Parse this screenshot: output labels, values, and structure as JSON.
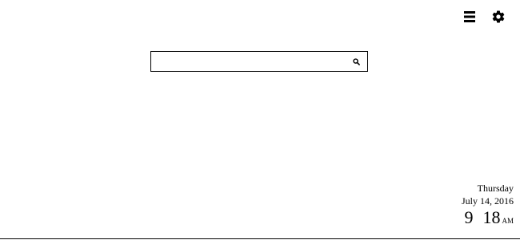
{
  "toolbar": {
    "menu_icon": "hamburger-menu-icon",
    "settings_icon": "gear-icon"
  },
  "search": {
    "value": "",
    "placeholder": "",
    "icon": "search-icon"
  },
  "clock": {
    "day": "Thursday",
    "date": "July 14, 2016",
    "hour": "9",
    "minute": "18",
    "ampm": "AM"
  },
  "colors": {
    "background": "#ffffff",
    "foreground": "#000000"
  }
}
